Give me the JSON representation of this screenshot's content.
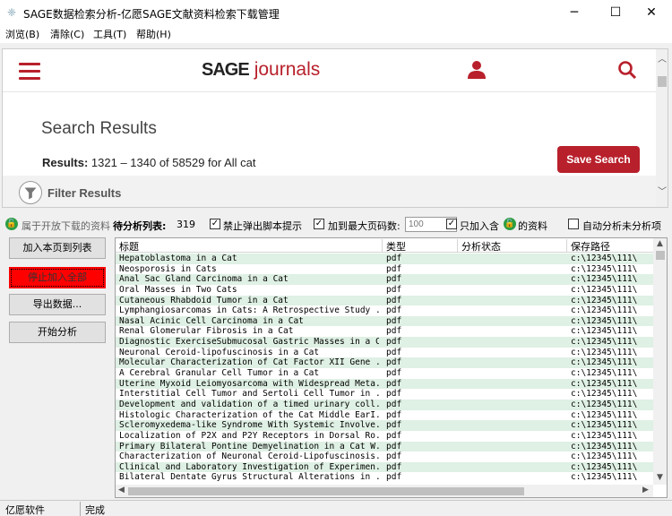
{
  "window": {
    "title": "SAGE数据检索分析-亿愿SAGE文献资料检索下载管理",
    "minimize": "─",
    "maximize": "☐",
    "close": "✕"
  },
  "menu": [
    "浏览(B)",
    "清除(C)",
    "工具(T)",
    "帮助(H)"
  ],
  "site": {
    "logo_main": "SAGE",
    "logo_sub": "journals",
    "search_results_title": "Search Results",
    "results_label": "Results:",
    "results_text": " 1321 – 1340 of 58529 for All cat",
    "save_search": "Save Search",
    "filter_results": "Filter Results",
    "brand_color": "#b8202b"
  },
  "options": {
    "open_access_label": "属于开放下载的资料",
    "pending_label": "待分析列表:",
    "pending_count": "319",
    "block_popup": "禁止弹出脚本提示",
    "max_pages_label": "加到最大页码数:",
    "max_pages_placeholder": "100",
    "only_add_label": "只加入含",
    "only_add_suffix": "的资料",
    "auto_analyze": "自动分析未分析项"
  },
  "buttons": {
    "add_page": "加入本页到列表",
    "stop_add": "停止加入全部",
    "export": "导出数据...",
    "start": "开始分析"
  },
  "table": {
    "headers": [
      "标题",
      "类型",
      "分析状态",
      "保存路径"
    ],
    "rows": [
      [
        "Hepatoblastoma in a Cat",
        "pdf",
        "",
        "c:\\12345\\111\\"
      ],
      [
        "Neosporosis in Cats",
        "pdf",
        "",
        "c:\\12345\\111\\"
      ],
      [
        "Anal Sac Gland Carcinoma in a Cat",
        "pdf",
        "",
        "c:\\12345\\111\\"
      ],
      [
        "Oral Masses in Two Cats",
        "pdf",
        "",
        "c:\\12345\\111\\"
      ],
      [
        "Cutaneous Rhabdoid Tumor in a Cat",
        "pdf",
        "",
        "c:\\12345\\111\\"
      ],
      [
        "Lymphangiosarcomas in Cats: A Retrospective Study ...",
        "pdf",
        "",
        "c:\\12345\\111\\"
      ],
      [
        "Nasal Acinic Cell Carcinoma in a Cat",
        "pdf",
        "",
        "c:\\12345\\111\\"
      ],
      [
        "Renal Glomerular Fibrosis in a Cat",
        "pdf",
        "",
        "c:\\12345\\111\\"
      ],
      [
        "Diagnostic ExerciseSubmucosal Gastric Masses in a Cat",
        "pdf",
        "",
        "c:\\12345\\111\\"
      ],
      [
        "Neuronal Ceroid-lipofuscinosis in a Cat",
        "pdf",
        "",
        "c:\\12345\\111\\"
      ],
      [
        "Molecular Characterization of Cat Factor XII Gene ...",
        "pdf",
        "",
        "c:\\12345\\111\\"
      ],
      [
        "A Cerebral Granular Cell Tumor in a Cat",
        "pdf",
        "",
        "c:\\12345\\111\\"
      ],
      [
        "Uterine Myxoid Leiomyosarcoma with Widespread Meta...",
        "pdf",
        "",
        "c:\\12345\\111\\"
      ],
      [
        "Interstitial Cell Tumor and Sertoli Cell Tumor in ...",
        "pdf",
        "",
        "c:\\12345\\111\\"
      ],
      [
        "Development and validation of a timed urinary coll...",
        "pdf",
        "",
        "c:\\12345\\111\\"
      ],
      [
        "Histologic Characterization of the Cat Middle EarI...",
        "pdf",
        "",
        "c:\\12345\\111\\"
      ],
      [
        "Scleromyxedema-like Syndrome With Systemic Involve...",
        "pdf",
        "",
        "c:\\12345\\111\\"
      ],
      [
        "Localization of P2X and P2Y Receptors in Dorsal Ro...",
        "pdf",
        "",
        "c:\\12345\\111\\"
      ],
      [
        "Primary Bilateral Pontine Demyelination in a Cat W...",
        "pdf",
        "",
        "c:\\12345\\111\\"
      ],
      [
        "Characterization of Neuronal Ceroid-Lipofuscinosis...",
        "pdf",
        "",
        "c:\\12345\\111\\"
      ],
      [
        "Clinical and Laboratory Investigation of Experimen...",
        "pdf",
        "",
        "c:\\12345\\111\\"
      ],
      [
        "Bilateral Dentate Gyrus Structural Alterations in ...",
        "pdf",
        "",
        "c:\\12345\\111\\"
      ]
    ]
  },
  "status": {
    "left": "亿愿软件",
    "right": "完成"
  }
}
